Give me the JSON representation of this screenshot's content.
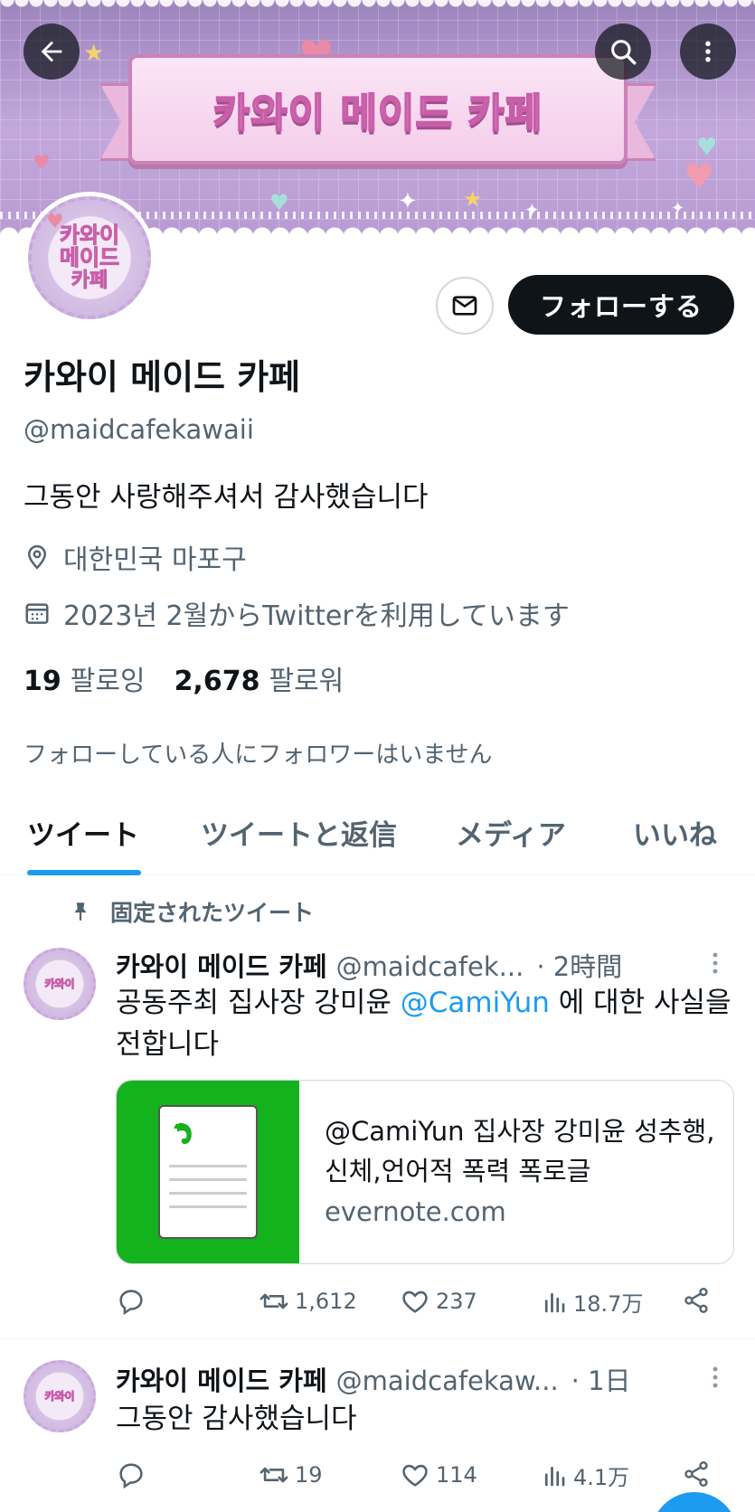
{
  "banner": {
    "title": "카와이 메이드 카페"
  },
  "avatar": {
    "line1": "카와이",
    "line2": "메이드",
    "line3": "카페"
  },
  "topbar": {
    "back_icon": "arrow-left-icon",
    "search_icon": "search-icon",
    "more_icon": "more-vertical-icon"
  },
  "profile": {
    "follow_label": "フォローする",
    "name": "카와이 메이드 카페",
    "handle": "@maidcafekawaii",
    "bio": "그동안 사랑해주셔서 감사했습니다",
    "location": "대한민국 마포구",
    "joined": "2023년 2월からTwitterを利用しています",
    "following_count": "19",
    "following_label": "팔로잉",
    "followers_count": "2,678",
    "followers_label": "팔로워",
    "no_mutual": "フォローしている人にフォロワーはいません"
  },
  "tabs": [
    {
      "label": "ツイート"
    },
    {
      "label": "ツイートと返信"
    },
    {
      "label": "メディア"
    },
    {
      "label": "いいね"
    }
  ],
  "pinned_label": "固定されたツイート",
  "tweets": [
    {
      "name": "카와이 메이드 카페",
      "handle": "@maidcafek...",
      "time": "· 2時間",
      "text_pre": "공동주최 집사장 강미윤 ",
      "mention": "@CamiYun",
      "text_post": " 에 대한 사실을 전합니다",
      "card": {
        "title": "@CamiYun 집사장 강미윤 성추행,신체,언어적 폭력 폭로글",
        "domain": "evernote.com"
      },
      "replies": "",
      "retweets": "1,612",
      "likes": "237",
      "views": "18.7万"
    },
    {
      "name": "카와이 메이드 카페",
      "handle": "@maidcafekaw...",
      "time": "· 1日",
      "text": "그동안 감사했습니다",
      "replies": "",
      "retweets": "19",
      "likes": "114",
      "views": "4.1万"
    }
  ],
  "colors": {
    "accent": "#1d9bf0",
    "text": "#0f1419",
    "muted": "#536471",
    "border": "#cfd9de",
    "evernote_green": "#14b21d"
  }
}
